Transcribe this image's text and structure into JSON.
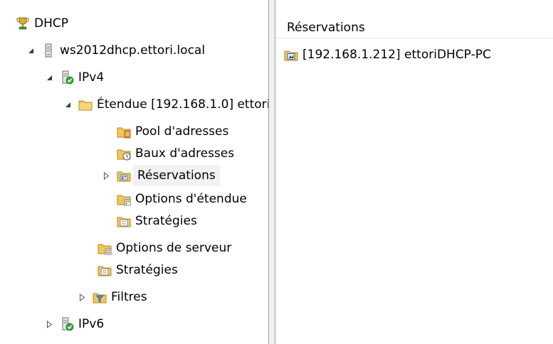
{
  "tree": {
    "root": {
      "label": "DHCP",
      "icon": "dhcp-trophy-icon"
    },
    "server": {
      "label": "ws2012dhcp.ettori.local",
      "icon": "server-icon"
    },
    "ipv4": {
      "label": "IPv4",
      "icon": "ipv4-icon"
    },
    "scope": {
      "label": "Étendue [192.168.1.0] ettori",
      "icon": "folder-icon"
    },
    "pool": {
      "label": "Pool d'adresses",
      "icon": "address-pool-icon"
    },
    "leases": {
      "label": "Baux d'adresses",
      "icon": "address-leases-icon"
    },
    "reservations": {
      "label": "Réservations",
      "icon": "reservations-icon"
    },
    "scope_options": {
      "label": "Options d'étendue",
      "icon": "scope-options-icon"
    },
    "scope_policies": {
      "label": "Stratégies",
      "icon": "policies-icon"
    },
    "server_options": {
      "label": "Options de serveur",
      "icon": "server-options-icon"
    },
    "policies": {
      "label": "Stratégies",
      "icon": "policies-icon"
    },
    "filters": {
      "label": "Filtres",
      "icon": "filters-icon"
    },
    "ipv6": {
      "label": "IPv6",
      "icon": "ipv6-icon"
    }
  },
  "list": {
    "header": "Réservations",
    "items": [
      {
        "label": "[192.168.1.212] ettoriDHCP-PC",
        "icon": "reservation-client-icon"
      }
    ]
  },
  "colors": {
    "folder": "#f1c75a",
    "selection": "#f2f2f2",
    "pane_border": "#a0a0a0",
    "green_check": "#3aa83a"
  }
}
